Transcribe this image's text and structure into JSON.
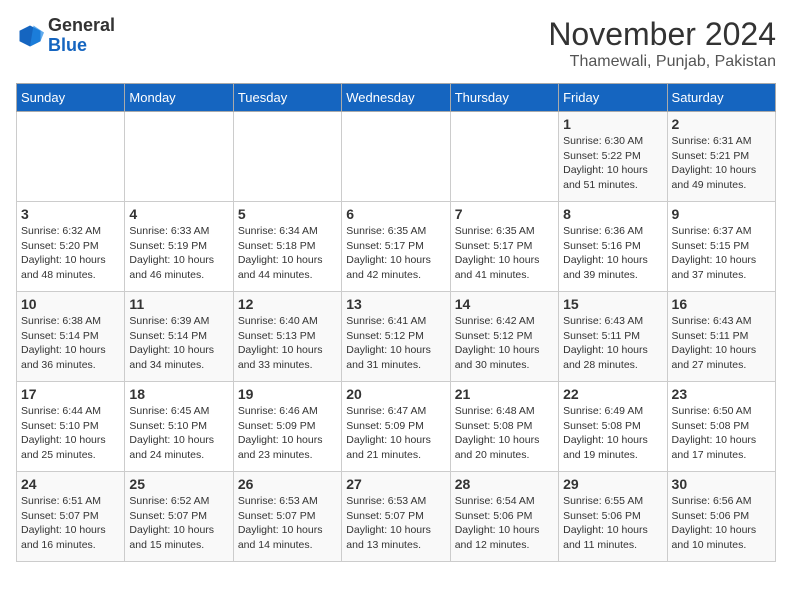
{
  "logo": {
    "general": "General",
    "blue": "Blue"
  },
  "title": "November 2024",
  "subtitle": "Thamewali, Punjab, Pakistan",
  "weekdays": [
    "Sunday",
    "Monday",
    "Tuesday",
    "Wednesday",
    "Thursday",
    "Friday",
    "Saturday"
  ],
  "weeks": [
    [
      {
        "day": "",
        "info": ""
      },
      {
        "day": "",
        "info": ""
      },
      {
        "day": "",
        "info": ""
      },
      {
        "day": "",
        "info": ""
      },
      {
        "day": "",
        "info": ""
      },
      {
        "day": "1",
        "info": "Sunrise: 6:30 AM\nSunset: 5:22 PM\nDaylight: 10 hours\nand 51 minutes."
      },
      {
        "day": "2",
        "info": "Sunrise: 6:31 AM\nSunset: 5:21 PM\nDaylight: 10 hours\nand 49 minutes."
      }
    ],
    [
      {
        "day": "3",
        "info": "Sunrise: 6:32 AM\nSunset: 5:20 PM\nDaylight: 10 hours\nand 48 minutes."
      },
      {
        "day": "4",
        "info": "Sunrise: 6:33 AM\nSunset: 5:19 PM\nDaylight: 10 hours\nand 46 minutes."
      },
      {
        "day": "5",
        "info": "Sunrise: 6:34 AM\nSunset: 5:18 PM\nDaylight: 10 hours\nand 44 minutes."
      },
      {
        "day": "6",
        "info": "Sunrise: 6:35 AM\nSunset: 5:17 PM\nDaylight: 10 hours\nand 42 minutes."
      },
      {
        "day": "7",
        "info": "Sunrise: 6:35 AM\nSunset: 5:17 PM\nDaylight: 10 hours\nand 41 minutes."
      },
      {
        "day": "8",
        "info": "Sunrise: 6:36 AM\nSunset: 5:16 PM\nDaylight: 10 hours\nand 39 minutes."
      },
      {
        "day": "9",
        "info": "Sunrise: 6:37 AM\nSunset: 5:15 PM\nDaylight: 10 hours\nand 37 minutes."
      }
    ],
    [
      {
        "day": "10",
        "info": "Sunrise: 6:38 AM\nSunset: 5:14 PM\nDaylight: 10 hours\nand 36 minutes."
      },
      {
        "day": "11",
        "info": "Sunrise: 6:39 AM\nSunset: 5:14 PM\nDaylight: 10 hours\nand 34 minutes."
      },
      {
        "day": "12",
        "info": "Sunrise: 6:40 AM\nSunset: 5:13 PM\nDaylight: 10 hours\nand 33 minutes."
      },
      {
        "day": "13",
        "info": "Sunrise: 6:41 AM\nSunset: 5:12 PM\nDaylight: 10 hours\nand 31 minutes."
      },
      {
        "day": "14",
        "info": "Sunrise: 6:42 AM\nSunset: 5:12 PM\nDaylight: 10 hours\nand 30 minutes."
      },
      {
        "day": "15",
        "info": "Sunrise: 6:43 AM\nSunset: 5:11 PM\nDaylight: 10 hours\nand 28 minutes."
      },
      {
        "day": "16",
        "info": "Sunrise: 6:43 AM\nSunset: 5:11 PM\nDaylight: 10 hours\nand 27 minutes."
      }
    ],
    [
      {
        "day": "17",
        "info": "Sunrise: 6:44 AM\nSunset: 5:10 PM\nDaylight: 10 hours\nand 25 minutes."
      },
      {
        "day": "18",
        "info": "Sunrise: 6:45 AM\nSunset: 5:10 PM\nDaylight: 10 hours\nand 24 minutes."
      },
      {
        "day": "19",
        "info": "Sunrise: 6:46 AM\nSunset: 5:09 PM\nDaylight: 10 hours\nand 23 minutes."
      },
      {
        "day": "20",
        "info": "Sunrise: 6:47 AM\nSunset: 5:09 PM\nDaylight: 10 hours\nand 21 minutes."
      },
      {
        "day": "21",
        "info": "Sunrise: 6:48 AM\nSunset: 5:08 PM\nDaylight: 10 hours\nand 20 minutes."
      },
      {
        "day": "22",
        "info": "Sunrise: 6:49 AM\nSunset: 5:08 PM\nDaylight: 10 hours\nand 19 minutes."
      },
      {
        "day": "23",
        "info": "Sunrise: 6:50 AM\nSunset: 5:08 PM\nDaylight: 10 hours\nand 17 minutes."
      }
    ],
    [
      {
        "day": "24",
        "info": "Sunrise: 6:51 AM\nSunset: 5:07 PM\nDaylight: 10 hours\nand 16 minutes."
      },
      {
        "day": "25",
        "info": "Sunrise: 6:52 AM\nSunset: 5:07 PM\nDaylight: 10 hours\nand 15 minutes."
      },
      {
        "day": "26",
        "info": "Sunrise: 6:53 AM\nSunset: 5:07 PM\nDaylight: 10 hours\nand 14 minutes."
      },
      {
        "day": "27",
        "info": "Sunrise: 6:53 AM\nSunset: 5:07 PM\nDaylight: 10 hours\nand 13 minutes."
      },
      {
        "day": "28",
        "info": "Sunrise: 6:54 AM\nSunset: 5:06 PM\nDaylight: 10 hours\nand 12 minutes."
      },
      {
        "day": "29",
        "info": "Sunrise: 6:55 AM\nSunset: 5:06 PM\nDaylight: 10 hours\nand 11 minutes."
      },
      {
        "day": "30",
        "info": "Sunrise: 6:56 AM\nSunset: 5:06 PM\nDaylight: 10 hours\nand 10 minutes."
      }
    ]
  ]
}
